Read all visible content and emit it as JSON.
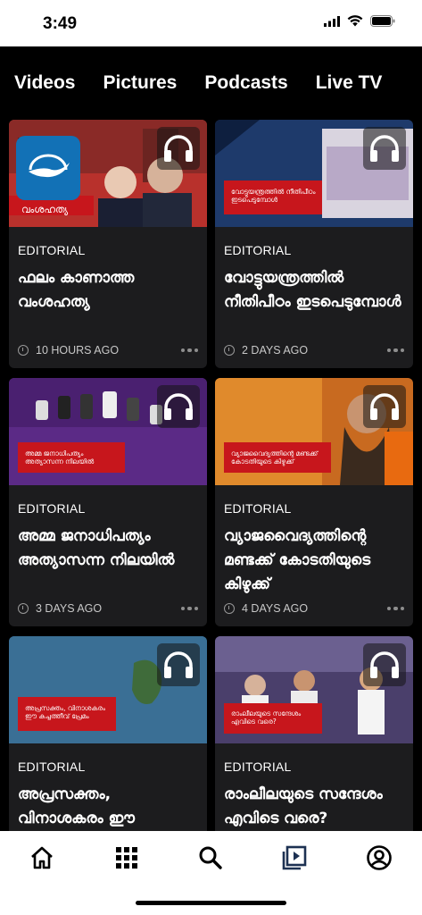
{
  "status_bar": {
    "time": "3:49",
    "icons": [
      "wifi-icon",
      "battery-icon"
    ]
  },
  "tabs": [
    {
      "label": "Videos"
    },
    {
      "label": "Pictures"
    },
    {
      "label": "Podcasts"
    },
    {
      "label": "Live TV"
    }
  ],
  "cards": [
    {
      "category": "EDITORIAL",
      "title": "ഫലം കാണാത്ത വംശഹത്യ",
      "time": "10 HOURS AGO",
      "thumb_text": "വംശഹത്യ"
    },
    {
      "category": "EDITORIAL",
      "title": "വോട്ടുയന്ത്രത്തിൽ നീതിപീഠം ഇടപെടുമ്പോൾ",
      "time": "2 DAYS AGO",
      "thumb_text": "വോട്ടുയന്ത്രത്തിൽ നീതിപീഠം ഇടപെടുമ്പോൾ"
    },
    {
      "category": "EDITORIAL",
      "title": "അമ്മ ജനാധിപത്യം അത്യാസന്ന നിലയിൽ",
      "time": "3 DAYS AGO",
      "thumb_text": "അമ്മ ജനാധിപത്യം അത്യാസന്ന നിലയിൽ"
    },
    {
      "category": "EDITORIAL",
      "title": "വ്യാജവൈദ്യത്തിന്റെ മണ്ടക്ക് കോടതിയുടെ കിഴുക്ക്",
      "time": "4 DAYS AGO",
      "thumb_text": "വ്യാജവൈദ്യത്തിന്റെ മണ്ടക്ക് കോടതിയുടെ കിഴുക്ക്"
    },
    {
      "category": "EDITORIAL",
      "title": "അപ്രസക്തം, വിനാശകരം ഈ കച്ചത്തീവ് പ്രേമം",
      "time": "",
      "thumb_text": "അപ്രസക്തം, വിനാശകരം ഈ കച്ചത്തീവ് പ്രേമം"
    },
    {
      "category": "EDITORIAL",
      "title": "രാംലീലയുടെ സന്ദേശം എവിടെ വരെ?",
      "time": "",
      "thumb_text": "രാംലീലയുടെ സന്ദേശം എവിടെ വരെ?"
    }
  ],
  "bottom_nav": [
    "home-icon",
    "grid-icon",
    "search-icon",
    "video-library-icon",
    "profile-icon"
  ],
  "colors": {
    "accent_red": "#c7161c",
    "background": "#000000",
    "card": "#1c1c1e",
    "logo_blue": "#1271b6"
  }
}
